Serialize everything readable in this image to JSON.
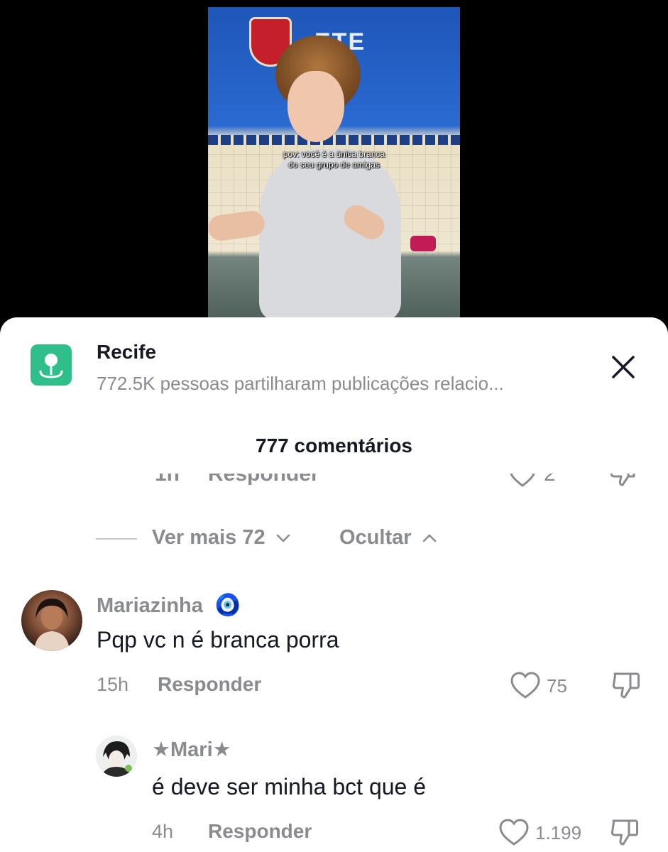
{
  "video": {
    "caption_line1": "pov: você é a única branca",
    "caption_line2": "do seu grupo de amigas",
    "school_sign": "ETE"
  },
  "location": {
    "title": "Recife",
    "subtitle": "772.5K pessoas partilharam publicações relacio..."
  },
  "comments_header": {
    "count_label": "777 comentários"
  },
  "previous_reply": {
    "time": "1h",
    "reply_label": "Responder",
    "likes": "2"
  },
  "thread_controls": {
    "view_more_label": "Ver mais 72",
    "hide_label": "Ocultar"
  },
  "comments": [
    {
      "username": "Mariazinha",
      "badge": "🧿",
      "text": "Pqp vc n é branca porra",
      "time": "15h",
      "reply_label": "Responder",
      "likes": "75"
    },
    {
      "username": "★Mari★",
      "text": "é deve ser minha bct que é",
      "time": "4h",
      "reply_label": "Responder",
      "likes": "1.199"
    }
  ],
  "colors": {
    "location_icon_bg": "#2fbf8a",
    "text_primary": "#161823",
    "text_secondary": "#8a8b91"
  }
}
